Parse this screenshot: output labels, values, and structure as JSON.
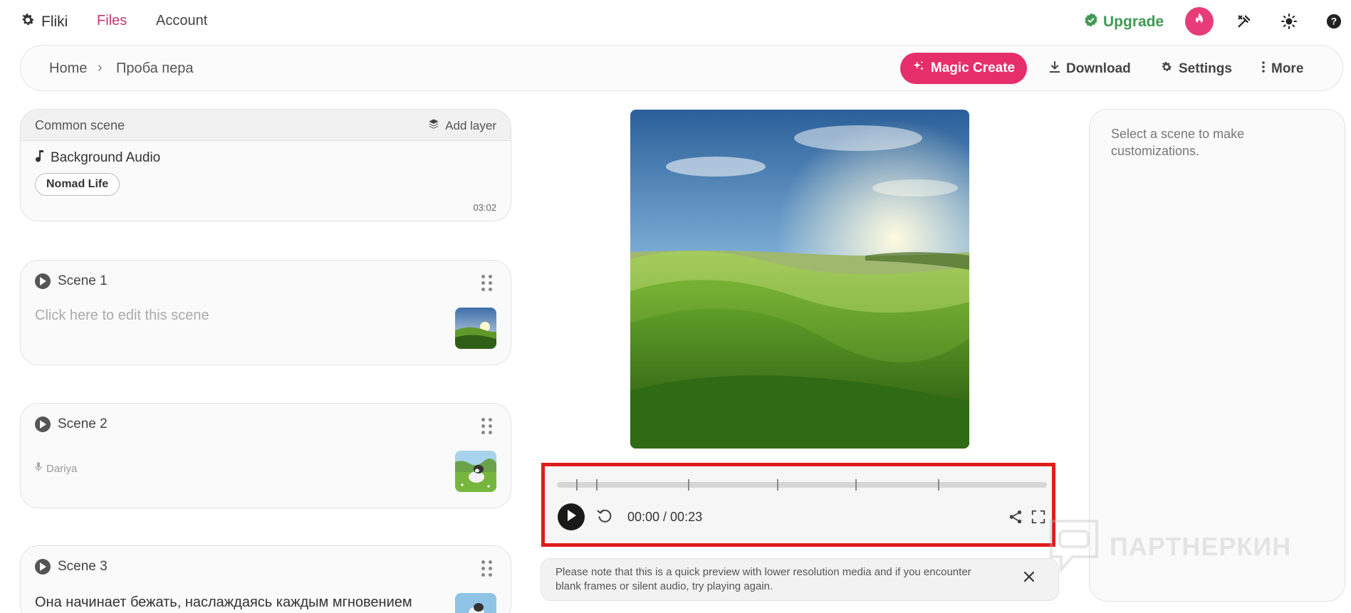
{
  "nav": {
    "brand": "Fliki",
    "files": "Files",
    "account": "Account",
    "upgrade": "Upgrade"
  },
  "breadcrumb": {
    "home": "Home",
    "separator": "›",
    "current": "Проба пера"
  },
  "toolbar": {
    "magic_create": "Magic Create",
    "download": "Download",
    "settings": "Settings",
    "more": "More"
  },
  "common_scene": {
    "title": "Common scene",
    "add_layer": "Add layer",
    "background_audio": "Background Audio",
    "track": "Nomad Life",
    "duration": "03:02"
  },
  "scenes": [
    {
      "label": "Scene 1",
      "placeholder": "Click here to edit this scene"
    },
    {
      "label": "Scene 2",
      "voice": "Dariya"
    },
    {
      "label": "Scene 3",
      "text": "Она начинает бежать, наслаждаясь каждым мгновением"
    }
  ],
  "player": {
    "time": "00:00 / 00:23",
    "notice": "Please note that this is a quick preview with lower resolution media and if you encounter blank frames or silent audio, try playing again."
  },
  "right_panel": {
    "hint": "Select a scene to make customizations."
  },
  "watermark": {
    "text": "ПАРТНЕРКИН"
  },
  "colors": {
    "accent": "#e62e6b",
    "files_active": "#c0396b",
    "upgrade_green": "#3f9a54",
    "highlight_border": "#e01c1c"
  },
  "icons": [
    "gear-icon",
    "check-badge-icon",
    "flame-icon",
    "tools-icon",
    "sun-icon",
    "help-icon",
    "sparkle-icon",
    "download-icon",
    "settings-icon",
    "more-vertical-icon",
    "layers-icon",
    "music-note-icon",
    "play-icon",
    "drag-handle-icon",
    "microphone-icon",
    "replay-icon",
    "share-icon",
    "fullscreen-icon",
    "close-icon"
  ]
}
